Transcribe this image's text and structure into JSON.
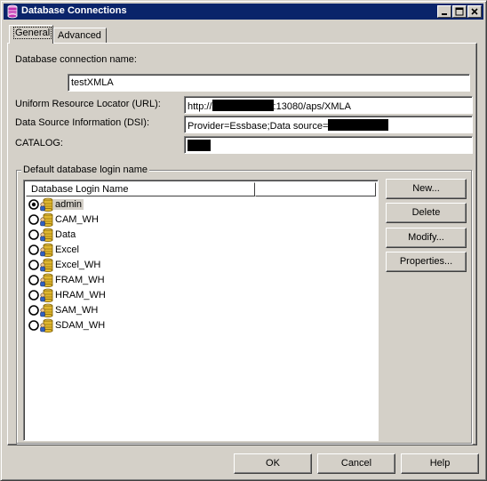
{
  "window": {
    "title": "Database Connections",
    "icon": "database-app-icon",
    "controls": [
      "minimize-icon",
      "maximize-icon",
      "close-icon"
    ]
  },
  "tabs": [
    {
      "label": "General",
      "active": true
    },
    {
      "label": "Advanced",
      "active": false
    }
  ],
  "general": {
    "conn_name_label": "Database connection name:",
    "conn_name_value": "testXMLA",
    "url_label": "Uniform Resource Locator (URL):",
    "url_prefix": "http://",
    "url_suffix": ":13080/aps/XMLA",
    "dsi_label": "Data Source Information (DSI):",
    "dsi_value": "Provider=Essbase;Data source=",
    "catalog_label": "CATALOG:"
  },
  "login_group": {
    "caption": "Default database login name",
    "column_header": "Database Login Name",
    "items": [
      {
        "label": "admin",
        "selected": true
      },
      {
        "label": "CAM_WH",
        "selected": false
      },
      {
        "label": "Data",
        "selected": false
      },
      {
        "label": "Excel",
        "selected": false
      },
      {
        "label": "Excel_WH",
        "selected": false
      },
      {
        "label": "FRAM_WH",
        "selected": false
      },
      {
        "label": "HRAM_WH",
        "selected": false
      },
      {
        "label": "SAM_WH",
        "selected": false
      },
      {
        "label": "SDAM_WH",
        "selected": false
      }
    ],
    "buttons": {
      "new": "New...",
      "delete": "Delete",
      "modify": "Modify...",
      "properties": "Properties..."
    }
  },
  "footer": {
    "ok": "OK",
    "cancel": "Cancel",
    "help": "Help"
  },
  "colors": {
    "titlebar": "#0a246a",
    "face": "#d4d0c8"
  }
}
